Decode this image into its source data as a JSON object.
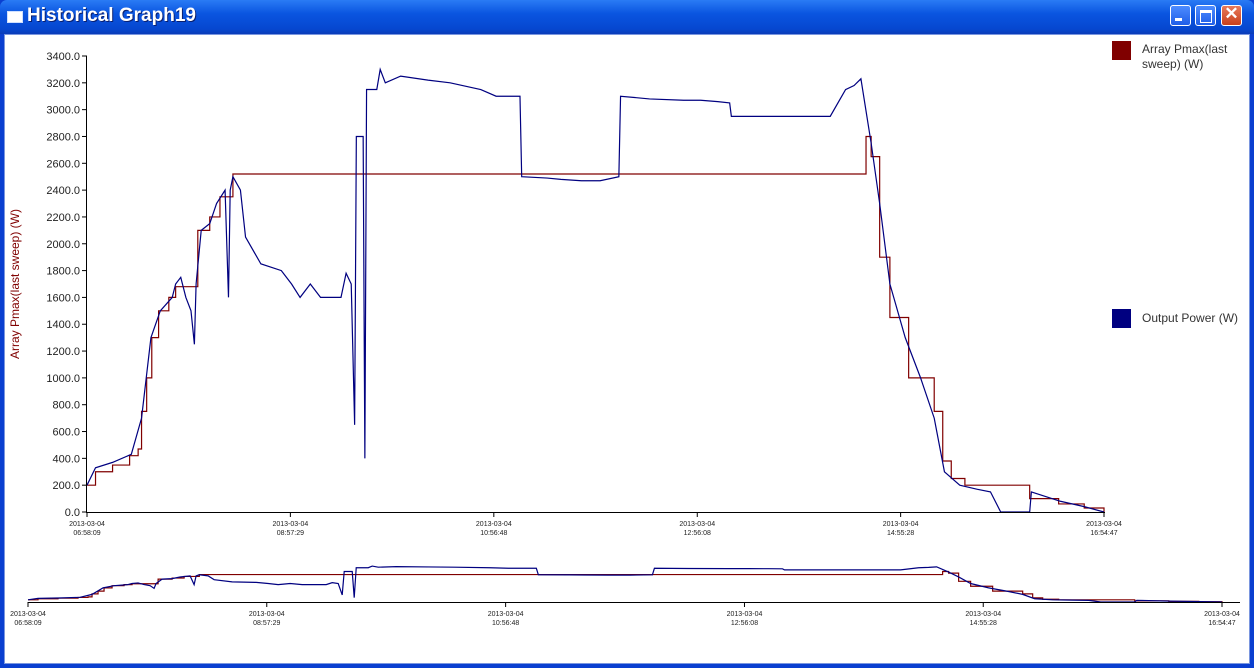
{
  "window": {
    "title": "Historical Graph19"
  },
  "legend": [
    {
      "label": "Array Pmax(last sweep) (W)",
      "color": "#800000"
    },
    {
      "label": "Output Power (W)",
      "color": "#000080"
    }
  ],
  "chart_data": {
    "type": "line",
    "ylabel": "Array Pmax(last sweep) (W)",
    "ylim": [
      0,
      3400
    ],
    "yticks": [
      "0.0",
      "200.0",
      "400.0",
      "600.0",
      "800.0",
      "1000.0",
      "1200.0",
      "1400.0",
      "1600.0",
      "1800.0",
      "2000.0",
      "2200.0",
      "2400.0",
      "2600.0",
      "2800.0",
      "3000.0",
      "3200.0",
      "3400.0"
    ],
    "x_unit": "minutes since 2013-03-04 06:58:09",
    "xlim": [
      0,
      596.6
    ],
    "xticks": [
      {
        "date": "2013-03-04",
        "time": "06:58:09",
        "min": 0
      },
      {
        "date": "2013-03-04",
        "time": "08:57:29",
        "min": 119.3
      },
      {
        "date": "2013-03-04",
        "time": "10:56:48",
        "min": 238.65
      },
      {
        "date": "2013-03-04",
        "time": "12:56:08",
        "min": 358
      },
      {
        "date": "2013-03-04",
        "time": "14:55:28",
        "min": 477.3
      },
      {
        "date": "2013-03-04",
        "time": "16:54:47",
        "min": 596.6
      }
    ],
    "series": [
      {
        "name": "Array Pmax(last sweep) (W)",
        "color": "#800000",
        "step": true,
        "points": [
          [
            0,
            200
          ],
          [
            5,
            300
          ],
          [
            15,
            350
          ],
          [
            25,
            420
          ],
          [
            30,
            470
          ],
          [
            32,
            750
          ],
          [
            35,
            1000
          ],
          [
            38,
            1300
          ],
          [
            42,
            1500
          ],
          [
            48,
            1600
          ],
          [
            52,
            1680
          ],
          [
            65,
            2100
          ],
          [
            72,
            2200
          ],
          [
            78,
            2350
          ],
          [
            85.6,
            2520
          ],
          [
            457,
            2800
          ],
          [
            460,
            2650
          ],
          [
            465,
            1900
          ],
          [
            471,
            1450
          ],
          [
            482,
            1000
          ],
          [
            497,
            750
          ],
          [
            502,
            380
          ],
          [
            507,
            250
          ],
          [
            515,
            200
          ],
          [
            553,
            200
          ],
          [
            553,
            100
          ],
          [
            570,
            60
          ],
          [
            585,
            30
          ],
          [
            596.6,
            0
          ]
        ]
      },
      {
        "name": "Output Power (W)",
        "color": "#000080",
        "step": false,
        "points": [
          [
            0,
            200
          ],
          [
            5,
            330
          ],
          [
            15,
            370
          ],
          [
            26,
            430
          ],
          [
            32,
            700
          ],
          [
            37.5,
            1300
          ],
          [
            43,
            1500
          ],
          [
            50,
            1600
          ],
          [
            52,
            1700
          ],
          [
            55,
            1750
          ],
          [
            58,
            1600
          ],
          [
            61,
            1500
          ],
          [
            63,
            1250
          ],
          [
            64,
            1700
          ],
          [
            67,
            2100
          ],
          [
            72,
            2150
          ],
          [
            76,
            2300
          ],
          [
            81,
            2400
          ],
          [
            83,
            1600
          ],
          [
            84,
            2400
          ],
          [
            85.6,
            2500
          ],
          [
            90,
            2400
          ],
          [
            93,
            2050
          ],
          [
            102,
            1850
          ],
          [
            114,
            1800
          ],
          [
            120,
            1700
          ],
          [
            125,
            1600
          ],
          [
            131,
            1700
          ],
          [
            137,
            1600
          ],
          [
            149,
            1600
          ],
          [
            152,
            1780
          ],
          [
            155,
            1700
          ],
          [
            157,
            650
          ],
          [
            158,
            2800
          ],
          [
            162,
            2800
          ],
          [
            163,
            400
          ],
          [
            164,
            3150
          ],
          [
            170,
            3150
          ],
          [
            172,
            3300
          ],
          [
            175,
            3200
          ],
          [
            184,
            3250
          ],
          [
            200,
            3220
          ],
          [
            213,
            3200
          ],
          [
            231,
            3150
          ],
          [
            240,
            3100
          ],
          [
            248,
            3100
          ],
          [
            254,
            3100
          ],
          [
            255,
            2500
          ],
          [
            270,
            2490
          ],
          [
            278,
            2480
          ],
          [
            290,
            2470
          ],
          [
            301,
            2470
          ],
          [
            312,
            2500
          ],
          [
            313,
            3100
          ],
          [
            330,
            3080
          ],
          [
            350,
            3070
          ],
          [
            360,
            3070
          ],
          [
            370,
            3060
          ],
          [
            377,
            3050
          ],
          [
            378,
            2950
          ],
          [
            400,
            2950
          ],
          [
            418,
            2950
          ],
          [
            436,
            2950
          ],
          [
            445,
            3150
          ],
          [
            450,
            3180
          ],
          [
            454,
            3230
          ],
          [
            460,
            2750
          ],
          [
            465,
            2300
          ],
          [
            471,
            1700
          ],
          [
            480,
            1300
          ],
          [
            489,
            1000
          ],
          [
            497,
            700
          ],
          [
            503,
            300
          ],
          [
            512,
            200
          ],
          [
            522,
            170
          ],
          [
            530,
            150
          ],
          [
            536,
            0
          ],
          [
            553,
            0
          ],
          [
            554,
            150
          ],
          [
            571,
            80
          ],
          [
            585,
            40
          ],
          [
            596.6,
            0
          ]
        ]
      }
    ]
  }
}
